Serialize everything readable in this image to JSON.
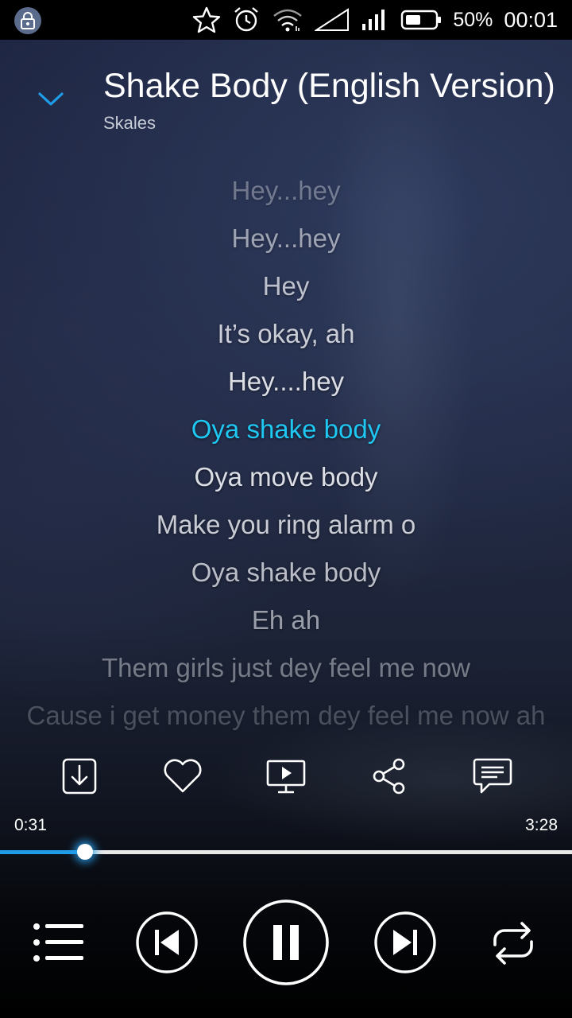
{
  "status_bar": {
    "icons": [
      "lock-icon",
      "star-icon",
      "alarm-icon",
      "wifi-icon",
      "signal-icon",
      "signal-bars-icon",
      "battery-icon"
    ],
    "battery_percent": "50%",
    "time": "00:01"
  },
  "header": {
    "title": "Shake Body (English Version)",
    "artist": "Skales"
  },
  "lyrics": {
    "lines": [
      {
        "text": "Hey...hey",
        "opacity": 0.38
      },
      {
        "text": "Hey...hey",
        "opacity": 0.62
      },
      {
        "text": "Hey",
        "opacity": 0.78
      },
      {
        "text": "It’s okay, ah",
        "opacity": 0.85
      },
      {
        "text": "Hey....hey",
        "opacity": 0.95
      },
      {
        "text": "Oya shake body",
        "opacity": 1,
        "active": true
      },
      {
        "text": "Oya move body",
        "opacity": 0.95
      },
      {
        "text": "Make you ring alarm o",
        "opacity": 0.85
      },
      {
        "text": "Oya shake body",
        "opacity": 0.78
      },
      {
        "text": "Eh ah",
        "opacity": 0.62
      },
      {
        "text": "Them girls just dey feel me now",
        "opacity": 0.45
      },
      {
        "text": "Cause i get money them dey feel me now ah",
        "opacity": 0.25
      }
    ],
    "active_color": "#1ec8f2"
  },
  "actions": [
    "download-icon",
    "heart-icon",
    "video-icon",
    "share-icon",
    "comment-icon"
  ],
  "progress": {
    "current": "0:31",
    "total": "3:28",
    "fraction": 0.149
  },
  "controls": [
    "playlist-icon",
    "previous-icon",
    "pause-icon",
    "next-icon",
    "repeat-icon"
  ],
  "colors": {
    "accent": "#1e9ce8"
  }
}
